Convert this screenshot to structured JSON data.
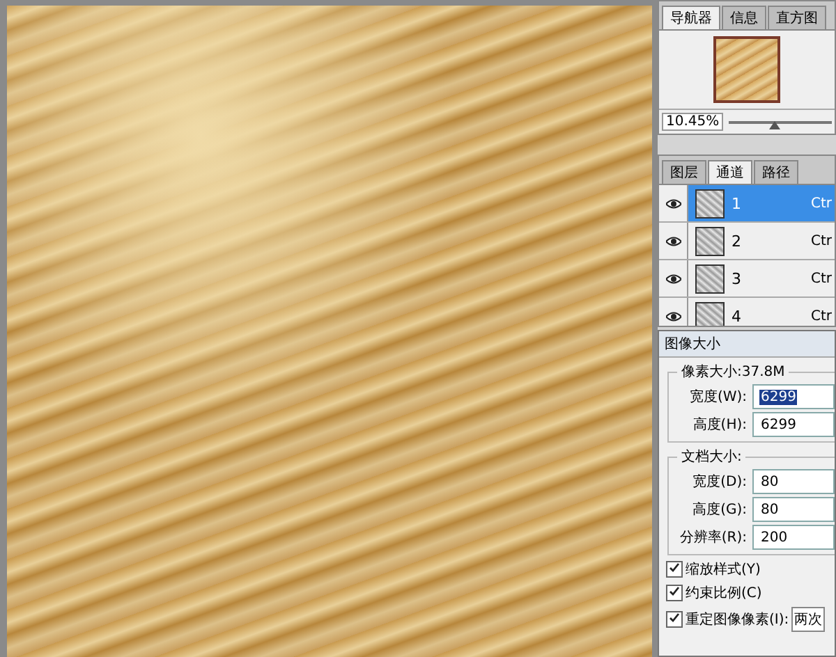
{
  "navigator": {
    "tabs": [
      {
        "label": "导航器",
        "selected": true
      },
      {
        "label": "信息",
        "selected": false
      },
      {
        "label": "直方图",
        "selected": false
      }
    ],
    "zoom": "10.45%",
    "level": 0.45
  },
  "channels_panel": {
    "tabs": [
      {
        "label": "图层",
        "selected": false
      },
      {
        "label": "通道",
        "selected": true
      },
      {
        "label": "路径",
        "selected": false
      }
    ],
    "channels": [
      {
        "name": "1",
        "shortcut": "Ctr",
        "selected": true,
        "visible": true
      },
      {
        "name": "2",
        "shortcut": "Ctr",
        "selected": false,
        "visible": true
      },
      {
        "name": "3",
        "shortcut": "Ctr",
        "selected": false,
        "visible": true
      },
      {
        "name": "4",
        "shortcut": "Ctr",
        "selected": false,
        "visible": true
      }
    ]
  },
  "image_size_dialog": {
    "title": "图像大小",
    "pixel_group": "像素大小:37.8M",
    "pixel_fields": [
      {
        "label": "宽度(W):",
        "value": "6299",
        "selected": true
      },
      {
        "label": "高度(H):",
        "value": "6299",
        "selected": false
      }
    ],
    "document_group": "文档大小:",
    "document_fields": [
      {
        "label": "宽度(D):",
        "value": "80",
        "selected": false
      },
      {
        "label": "高度(G):",
        "value": "80",
        "selected": false
      },
      {
        "label": "分辨率(R):",
        "value": "200",
        "selected": false
      }
    ],
    "options": [
      {
        "label": "缩放样式(Y)",
        "checked": true
      },
      {
        "label": "约束比例(C)",
        "checked": true
      },
      {
        "label": "重定图像像素(I):",
        "checked": true,
        "dropdown": "两次"
      }
    ]
  }
}
